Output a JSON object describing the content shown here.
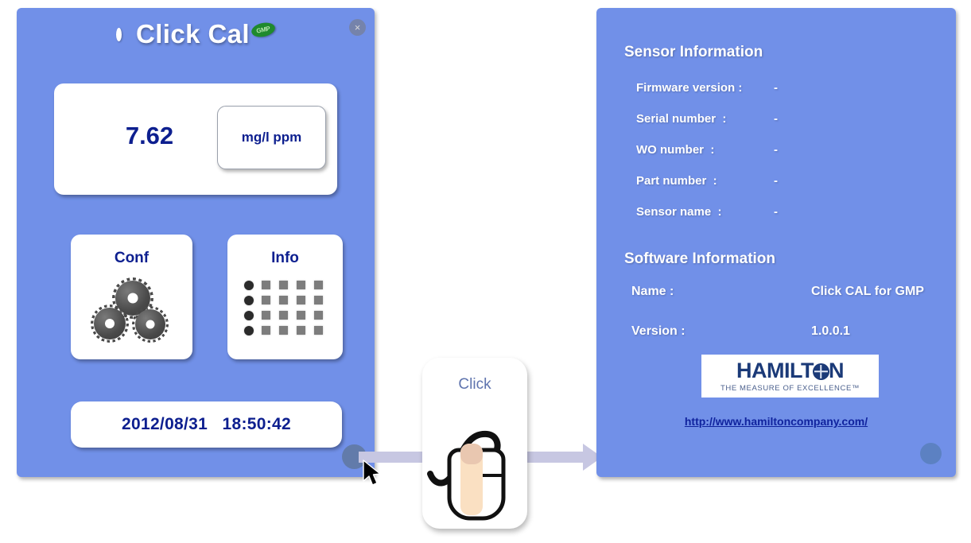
{
  "app": {
    "title": "Click Cal",
    "gmp_badge": "GMP",
    "close_label": "×"
  },
  "left_panel": {
    "reading": {
      "value": "7.62",
      "unit_label": "mg/l ppm"
    },
    "buttons": [
      {
        "label": "Conf",
        "icon": "gears-icon"
      },
      {
        "label": "Info",
        "icon": "dot-grid-icon"
      }
    ],
    "datetime": "2012/08/31   18:50:42"
  },
  "middle": {
    "click_label": "Click",
    "mouse_icon": "mouse-click-icon",
    "arrow_icon": "arrow-right-icon",
    "cursor_icon": "mouse-pointer-icon"
  },
  "right_panel": {
    "sensor_section": {
      "title": "Sensor Information",
      "rows": [
        {
          "label": "Firmware version :",
          "value": "-"
        },
        {
          "label": "Serial number  :",
          "value": "-"
        },
        {
          "label": "WO number  :",
          "value": "-"
        },
        {
          "label": "Part number  :",
          "value": "-"
        },
        {
          "label": "Sensor name  :",
          "value": "-"
        }
      ]
    },
    "software_section": {
      "title": "Software Information",
      "rows": [
        {
          "label": "Name :",
          "value": "Click CAL for GMP"
        },
        {
          "label": "Version :",
          "value": "1.0.0.1"
        }
      ]
    },
    "logo": {
      "wordmark_start": "HAMILT",
      "wordmark_end": "N",
      "globe_icon": "globe-o-icon",
      "tagline": "THE MEASURE OF EXCELLENCE™"
    },
    "url": "http://www.hamiltoncompany.com/"
  },
  "colors": {
    "panel_blue": "#7190e8",
    "text_navy": "#0d1f8f",
    "link_blue": "#10239e",
    "gmp_green": "#1f8a2e",
    "arrow_lavender": "#c7c7e2"
  }
}
